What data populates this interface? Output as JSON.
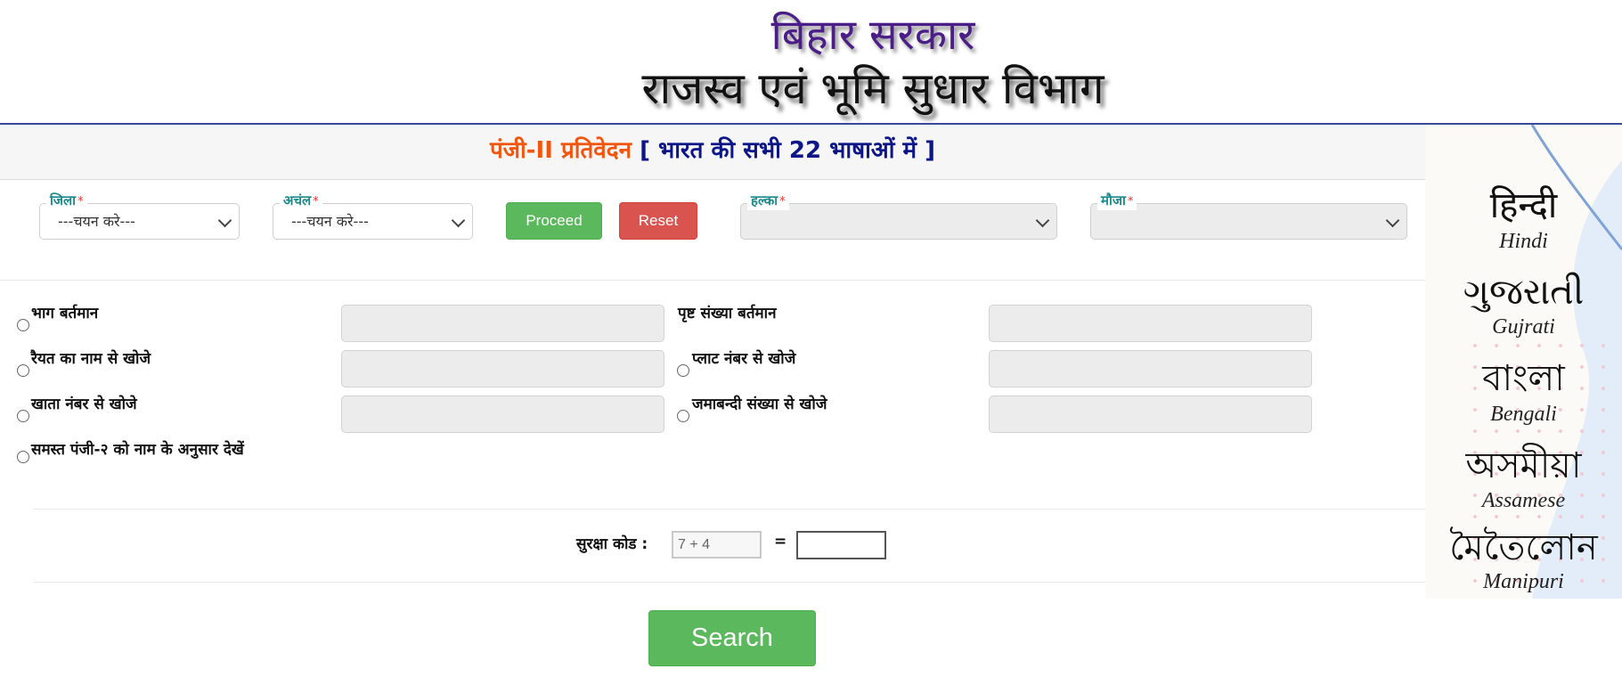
{
  "header": {
    "government": "बिहार सरकार",
    "department": "राजस्व एवं भूमि सुधार विभाग"
  },
  "titlebar": {
    "title": "पंजी-II प्रतिवेदन",
    "subtitle": "[ भारत की सभी 22 भाषाओं में ]"
  },
  "filters": {
    "district": {
      "label": "जिला",
      "required": "*",
      "value": "---चयन करे---"
    },
    "circle": {
      "label": "अचंल",
      "required": "*",
      "value": "---चयन करे---"
    },
    "proceed_label": "Proceed",
    "reset_label": "Reset",
    "halka": {
      "label": "हल्का",
      "required": "*",
      "value": ""
    },
    "mauja": {
      "label": "मौजा",
      "required": "*",
      "value": ""
    }
  },
  "search_options": {
    "bhag": {
      "label": "भाग बर्तमान",
      "value": ""
    },
    "prishth": {
      "label": "पृष्ट संख्या बर्तमान",
      "value": ""
    },
    "raiyat": {
      "label": "रैयत का नाम से खोजे",
      "value": ""
    },
    "plot": {
      "label": "प्लाट नंबर से खोजे",
      "value": ""
    },
    "khata": {
      "label": "खाता नंबर से खोजे",
      "value": ""
    },
    "jamabandi": {
      "label": "जमाबन्दी संख्या से खोजे",
      "value": ""
    },
    "all": {
      "label": "समस्त पंजी-२ को नाम के अनुसार देखें"
    }
  },
  "captcha": {
    "label": "सुरक्षा कोड :",
    "question": "7 + 4",
    "equals": "=",
    "answer": ""
  },
  "search_label": "Search",
  "languages": [
    {
      "native": "हिन्दी",
      "english": "Hindi"
    },
    {
      "native": "ગુજરાતી",
      "english": "Gujrati"
    },
    {
      "native": "বাংলা",
      "english": "Bengali"
    },
    {
      "native": "অসমীয়া",
      "english": "Assamese"
    },
    {
      "native": "মৈতৈলোন",
      "english": "Manipuri"
    }
  ]
}
